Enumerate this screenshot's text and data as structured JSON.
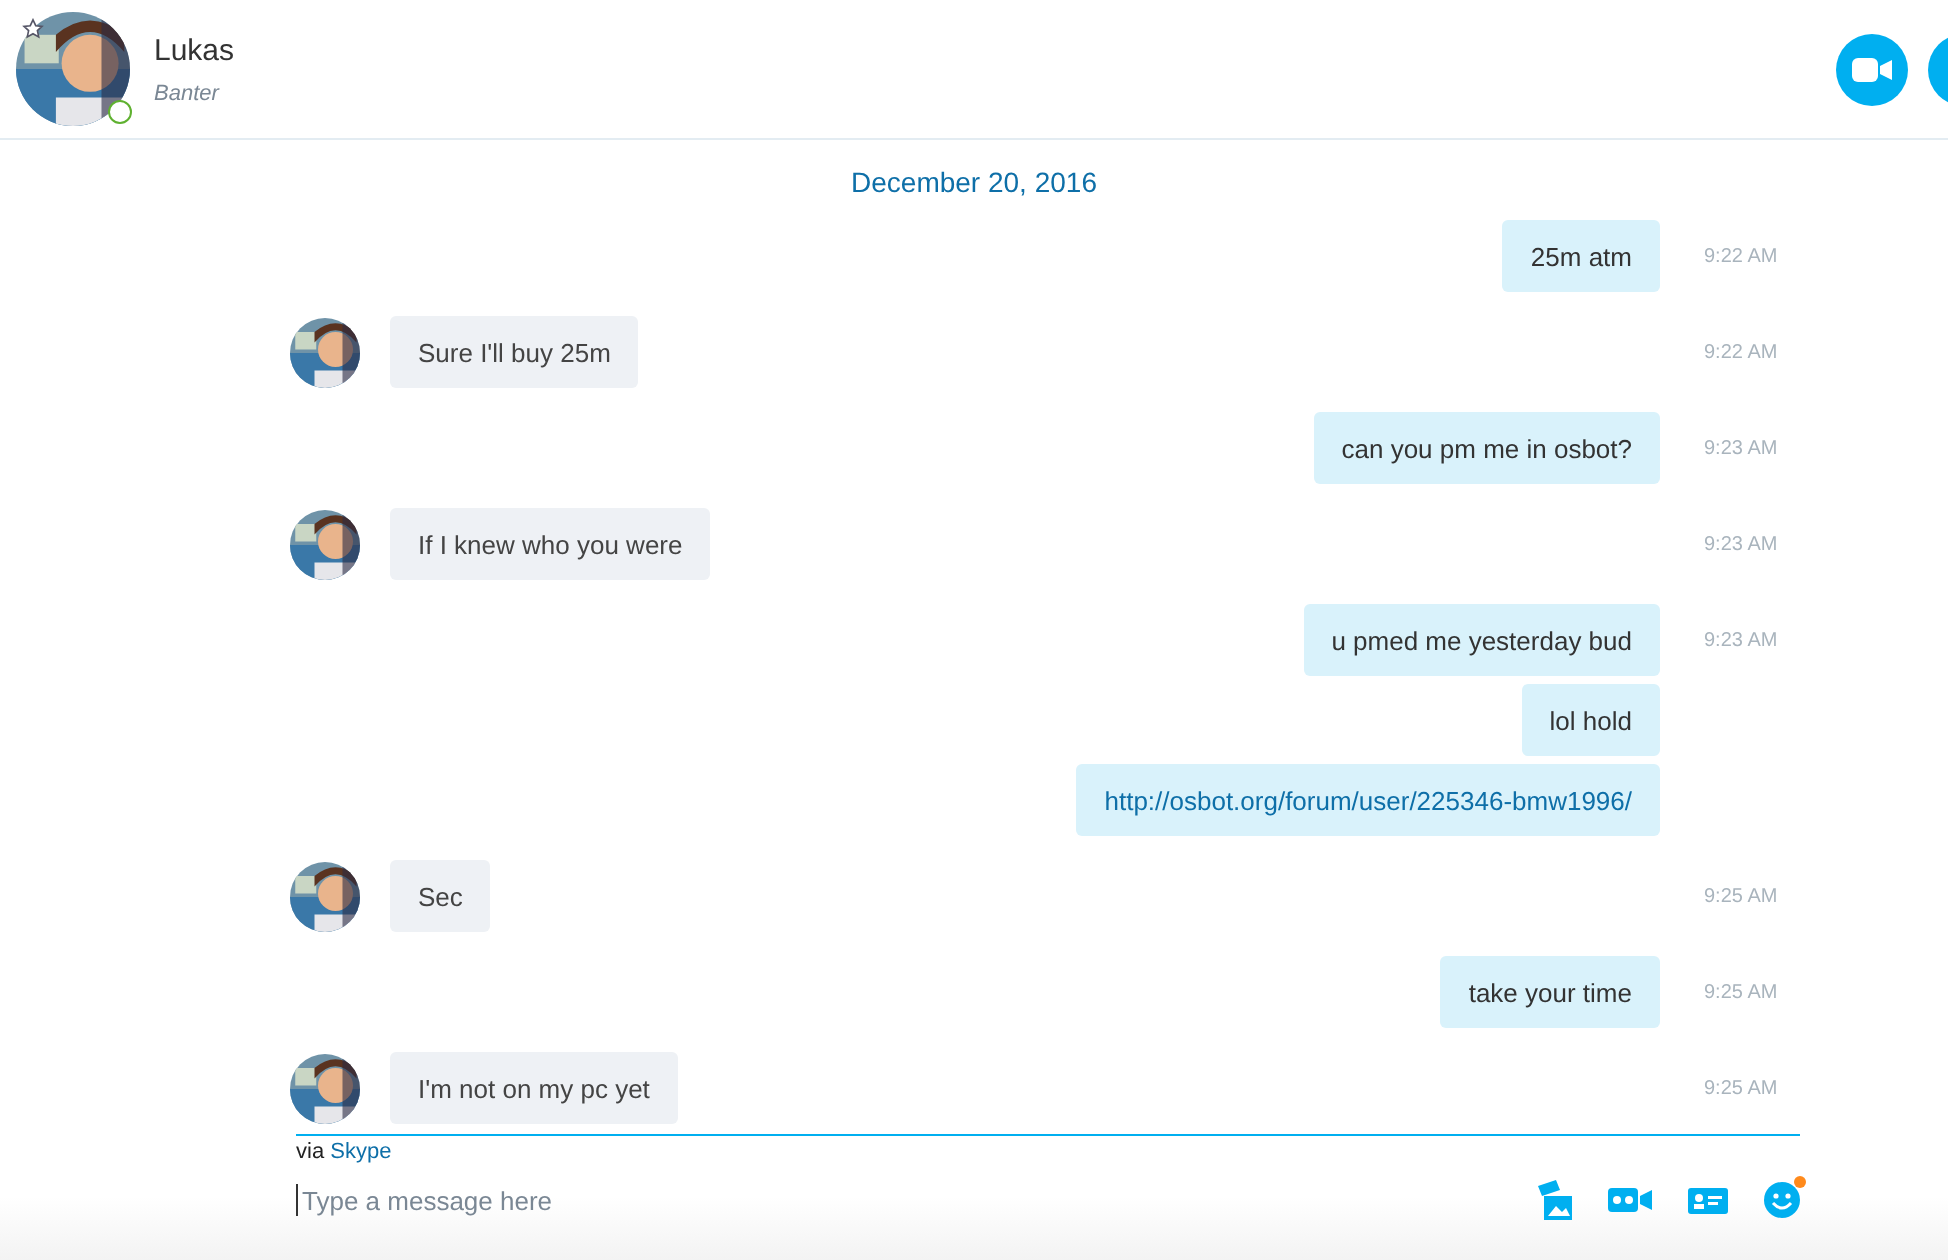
{
  "header": {
    "name": "Lukas",
    "mood": "Banter",
    "online": true,
    "favorite": true
  },
  "date_divider": "December 20, 2016",
  "messages": [
    {
      "outgoing": true,
      "text": "25m atm",
      "time": "9:22 AM",
      "kind": "text"
    },
    {
      "outgoing": false,
      "text": "Sure I'll buy 25m",
      "time": "9:22 AM",
      "kind": "text"
    },
    {
      "outgoing": true,
      "text": "can you pm me in osbot?",
      "time": "9:23 AM",
      "kind": "text"
    },
    {
      "outgoing": false,
      "text": "If I knew who you were",
      "time": "9:23 AM",
      "kind": "text"
    },
    {
      "outgoing": true,
      "text": "u pmed me yesterday bud",
      "time": "9:23 AM",
      "kind": "text"
    },
    {
      "outgoing": true,
      "text": "lol hold",
      "kind": "text"
    },
    {
      "outgoing": true,
      "text": "http://osbot.org/forum/user/225346-bmw1996/",
      "kind": "link"
    },
    {
      "outgoing": false,
      "text": "Sec",
      "time": "9:25 AM",
      "kind": "text"
    },
    {
      "outgoing": true,
      "text": "take your time",
      "time": "9:25 AM",
      "kind": "text"
    },
    {
      "outgoing": false,
      "text": "I'm not on my pc yet",
      "time": "9:25 AM",
      "kind": "text"
    }
  ],
  "composer": {
    "via": "via",
    "service": "Skype",
    "placeholder": "Type a message here",
    "emoji_notification": true
  }
}
